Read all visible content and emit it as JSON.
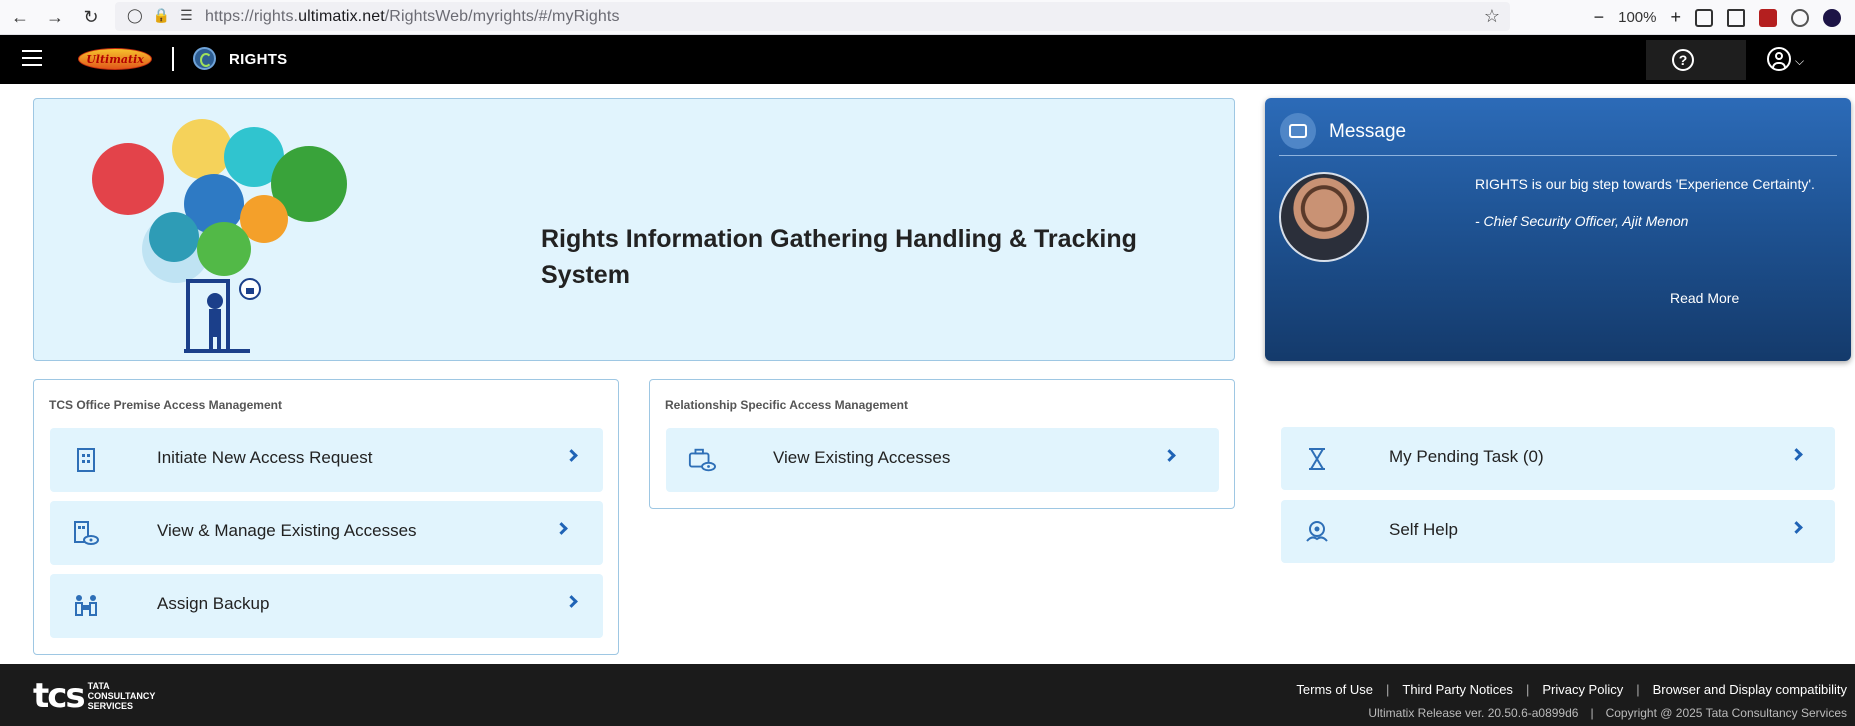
{
  "browser": {
    "url_prefix": "https://rights.",
    "url_domain": "ultimatix.net",
    "url_path": "/RightsWeb/myrights/#/myRights",
    "zoom": "100%"
  },
  "header": {
    "logo_text": "Ultimatix",
    "app_title": "RIGHTS"
  },
  "banner": {
    "title_line1": "Rights Information Gathering Handling & Tracking",
    "title_line2": "System"
  },
  "message": {
    "title": "Message",
    "quote": "RIGHTS is our big step towards 'Experience Certainty'.",
    "author": "- Chief Security Officer, Ajit Menon",
    "read_more": "Read More"
  },
  "premise_card": {
    "heading": "TCS Office Premise Access Management",
    "tiles": [
      {
        "label": "Initiate New Access Request",
        "icon": "building-icon"
      },
      {
        "label": "View & Manage Existing Accesses",
        "icon": "building-eye-icon"
      },
      {
        "label": "Assign Backup",
        "icon": "people-handover-icon"
      }
    ]
  },
  "relationship_card": {
    "heading": "Relationship Specific Access Management",
    "tiles": [
      {
        "label": "View Existing Accesses",
        "icon": "briefcase-eye-icon"
      }
    ]
  },
  "side_tiles": [
    {
      "label": "My Pending Task (0)",
      "icon": "hourglass-icon"
    },
    {
      "label": "Self Help",
      "icon": "self-help-icon"
    }
  ],
  "footer": {
    "logo_line1": "TATA",
    "logo_line2": "CONSULTANCY",
    "logo_line3": "SERVICES",
    "links": [
      "Terms of Use",
      "Third Party Notices",
      "Privacy Policy",
      "Browser and Display compatibility"
    ],
    "release": "Ultimatix Release ver. 20.50.6-a0899d6",
    "copyright": "Copyright @ 2025 Tata Consultancy Services"
  },
  "colors": {
    "accent": "#1f63b6",
    "tile_bg": "#e1f4fd",
    "header_bg": "#000000",
    "footer_bg": "#1b1b1b"
  }
}
